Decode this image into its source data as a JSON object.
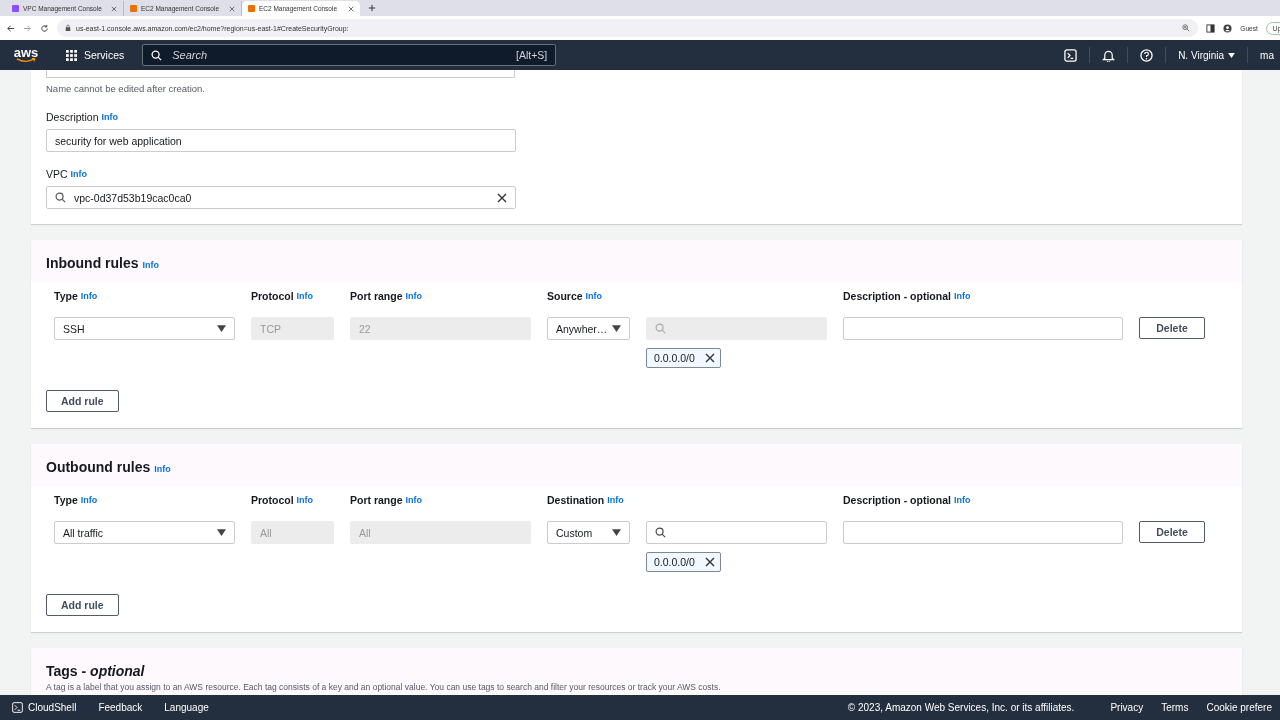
{
  "browser": {
    "tabs": [
      {
        "title": "VPC Management Console",
        "selected": false,
        "color": "#8c4fff"
      },
      {
        "title": "EC2 Management Console",
        "selected": false,
        "color": "#ed7100"
      },
      {
        "title": "EC2 Management Console",
        "selected": true,
        "color": "#ed7100"
      }
    ],
    "url": "us-east-1.console.aws.amazon.com/ec2/home?region=us-east-1#CreateSecurityGroup:",
    "profile": "Guest",
    "update": "Up"
  },
  "nav": {
    "logo": "aws",
    "services": "Services",
    "search_placeholder": "Search",
    "shortcut": "[Alt+S]",
    "region": "N. Virginia",
    "account": "ma"
  },
  "basic": {
    "name_hint": "Name cannot be edited after creation.",
    "description": {
      "label": "Description",
      "info": "Info",
      "value": "security for web application"
    },
    "vpc": {
      "label": "VPC",
      "info": "Info",
      "value": "vpc-0d37d53b19cac0ca0"
    }
  },
  "rule_sections": [
    {
      "title": "Inbound rules",
      "info": "Info",
      "columns": [
        {
          "label": "Type",
          "info": "Info"
        },
        {
          "label": "Protocol",
          "info": "Info"
        },
        {
          "label": "Port range",
          "info": "Info"
        },
        {
          "label": "Source",
          "info": "Info"
        },
        {
          "label": "Description - optional",
          "info": "Info"
        }
      ],
      "rows": [
        {
          "type": "SSH",
          "protocol": "TCP",
          "port_range": "22",
          "target": "Anywher…",
          "cidr_disabled": true,
          "tokens": [
            "0.0.0.0/0"
          ],
          "delete": "Delete"
        }
      ],
      "add_button": "Add rule"
    },
    {
      "title": "Outbound rules",
      "info": "Info",
      "columns": [
        {
          "label": "Type",
          "info": "Info"
        },
        {
          "label": "Protocol",
          "info": "Info"
        },
        {
          "label": "Port range",
          "info": "Info"
        },
        {
          "label": "Destination",
          "info": "Info"
        },
        {
          "label": "Description - optional",
          "info": "Info"
        }
      ],
      "rows": [
        {
          "type": "All traffic",
          "protocol": "All",
          "port_range": "All",
          "target": "Custom",
          "cidr_disabled": false,
          "tokens": [
            "0.0.0.0/0"
          ],
          "delete": "Delete"
        }
      ],
      "add_button": "Add rule"
    }
  ],
  "tags": {
    "title": "Tags - *optional*",
    "description": "A tag is a label that you assign to an AWS resource. Each tag consists of a key and an optional value. You can use tags to search and filter your resources or track your AWS costs."
  },
  "footer": {
    "left": [
      "CloudShell",
      "Feedback",
      "Language"
    ],
    "copyright": "© 2023, Amazon Web Services, Inc. or its affiliates.",
    "links": [
      "Privacy",
      "Terms",
      "Cookie prefere"
    ]
  }
}
